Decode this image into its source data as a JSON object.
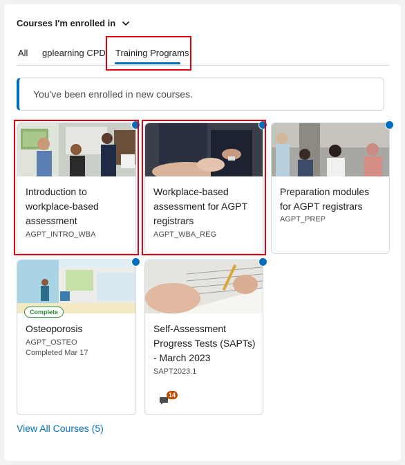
{
  "widget": {
    "title": "Courses I'm enrolled in"
  },
  "tabs": [
    {
      "label": "All"
    },
    {
      "label": "gplearning CPD"
    },
    {
      "label": "Training Programs"
    }
  ],
  "alert": {
    "text": "You've been enrolled in new courses."
  },
  "courses": [
    {
      "title": "Introduction to workplace-based assessment",
      "code": "AGPT_INTRO_WBA"
    },
    {
      "title": "Workplace-based assessment for AGPT registrars",
      "code": "AGPT_WBA_REG"
    },
    {
      "title": "Preparation modules for AGPT registrars",
      "code": "AGPT_PREP"
    },
    {
      "title": "Osteoporosis",
      "code": "AGPT_OSTEO",
      "status": "Complete",
      "completed": "Completed Mar 17"
    },
    {
      "title": "Self-Assessment Progress Tests (SAPTs) - March 2023",
      "code": "SAPT2023.1",
      "notification_count": "14"
    }
  ],
  "footer": {
    "view_all": "View All Courses (5)"
  },
  "colors": {
    "accent": "#006fbf",
    "highlight": "#e2000f",
    "complete": "#2e8b3a",
    "notification": "#c44a00"
  },
  "icons": [
    "chevron-down-icon",
    "new-course-dot-icon",
    "chat-bubble-icon"
  ]
}
